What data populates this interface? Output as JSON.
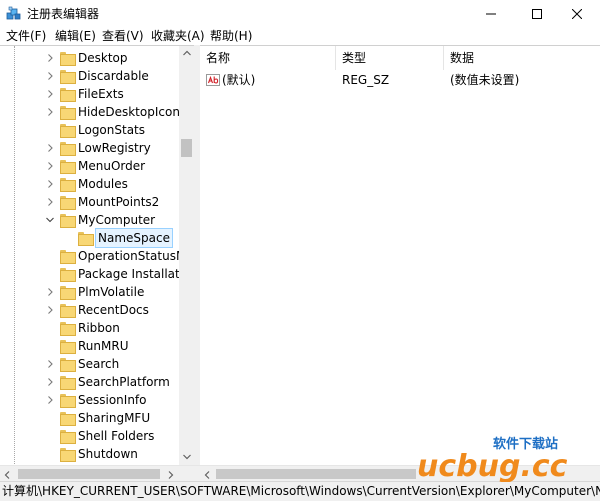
{
  "window": {
    "title": "注册表编辑器",
    "controls": {
      "minimize": "minimize",
      "maximize": "maximize",
      "close": "close"
    }
  },
  "menu": [
    "文件(F)",
    "编辑(E)",
    "查看(V)",
    "收藏夹(A)",
    "帮助(H)"
  ],
  "tree": {
    "items": [
      {
        "label": "Desktop",
        "expander": "collapsed",
        "level": 1
      },
      {
        "label": "Discardable",
        "expander": "collapsed",
        "level": 1
      },
      {
        "label": "FileExts",
        "expander": "collapsed",
        "level": 1
      },
      {
        "label": "HideDesktopIcons",
        "expander": "collapsed",
        "level": 1
      },
      {
        "label": "LogonStats",
        "expander": "none",
        "level": 1
      },
      {
        "label": "LowRegistry",
        "expander": "collapsed",
        "level": 1
      },
      {
        "label": "MenuOrder",
        "expander": "collapsed",
        "level": 1
      },
      {
        "label": "Modules",
        "expander": "collapsed",
        "level": 1
      },
      {
        "label": "MountPoints2",
        "expander": "collapsed",
        "level": 1
      },
      {
        "label": "MyComputer",
        "expander": "expanded",
        "level": 1
      },
      {
        "label": "NameSpace",
        "expander": "none",
        "level": 2,
        "selected": true
      },
      {
        "label": "OperationStatusMa",
        "expander": "none",
        "level": 1
      },
      {
        "label": "Package Installatio",
        "expander": "none",
        "level": 1
      },
      {
        "label": "PlmVolatile",
        "expander": "collapsed",
        "level": 1
      },
      {
        "label": "RecentDocs",
        "expander": "collapsed",
        "level": 1
      },
      {
        "label": "Ribbon",
        "expander": "none",
        "level": 1
      },
      {
        "label": "RunMRU",
        "expander": "none",
        "level": 1
      },
      {
        "label": "Search",
        "expander": "collapsed",
        "level": 1
      },
      {
        "label": "SearchPlatform",
        "expander": "collapsed",
        "level": 1
      },
      {
        "label": "SessionInfo",
        "expander": "collapsed",
        "level": 1
      },
      {
        "label": "SharingMFU",
        "expander": "none",
        "level": 1
      },
      {
        "label": "Shell Folders",
        "expander": "none",
        "level": 1
      },
      {
        "label": "Shutdown",
        "expander": "none",
        "level": 1
      }
    ]
  },
  "list": {
    "columns": [
      "名称",
      "类型",
      "数据"
    ],
    "rows": [
      {
        "icon": "string-value-icon",
        "name": "(默认)",
        "type": "REG_SZ",
        "data": "(数值未设置)"
      }
    ]
  },
  "status": {
    "path": "计算机\\HKEY_CURRENT_USER\\SOFTWARE\\Microsoft\\Windows\\CurrentVersion\\Explorer\\MyComputer\\NameSpace"
  },
  "watermark": {
    "brand": "ucbug.cc",
    "tagline": "软件下载站"
  },
  "colors": {
    "selection": "#e5f3ff",
    "folder": "#f8d775",
    "watermark_orange": "#f08a1c",
    "watermark_blue": "#1e6fc4"
  }
}
